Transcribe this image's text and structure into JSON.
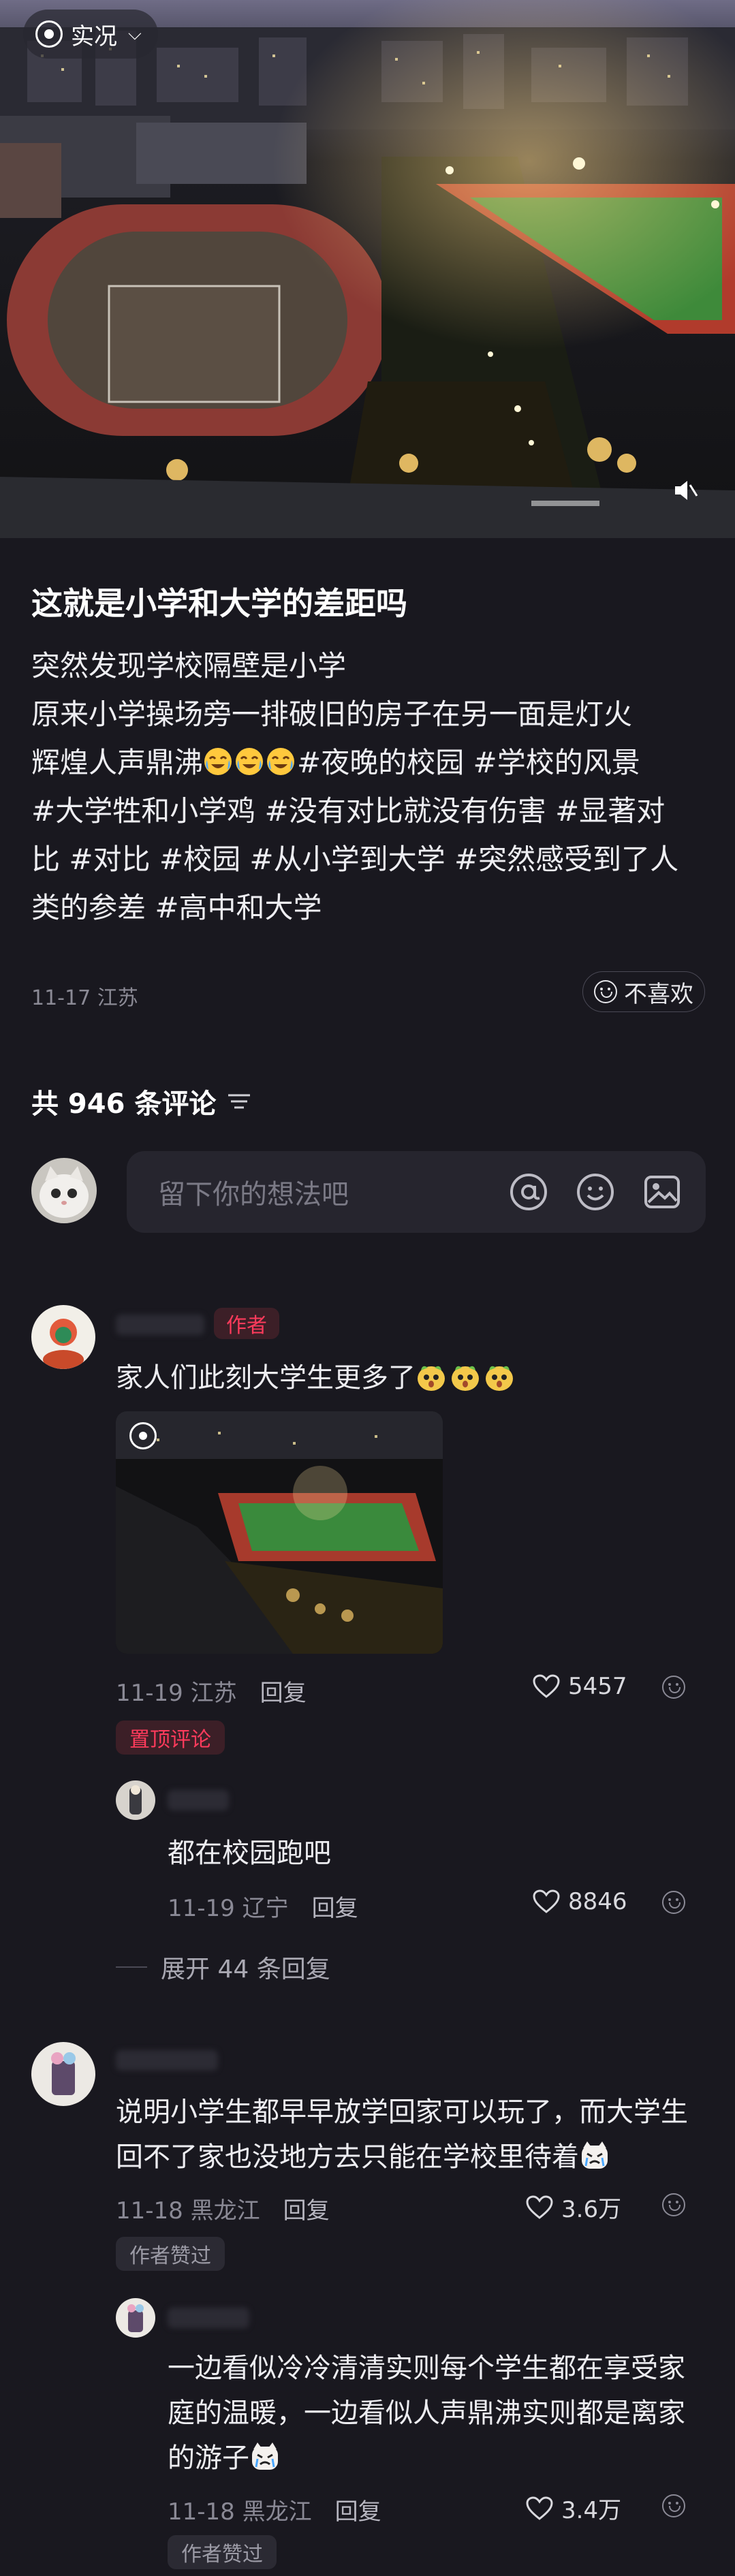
{
  "media": {
    "live_label": "实况",
    "mute_icon": "speaker-mute-icon"
  },
  "post": {
    "title": "这就是小学和大学的差距吗",
    "body_lines": [
      "突然发现学校隔壁是小学",
      "原来小学操场旁一排破旧的房子在另一面是灯火",
      "辉煌人声鼎沸",
      "#夜晚的校园 #学校的风景",
      "#大学牲和小学鸡 #没有对比就没有伤害 #显著对",
      "比 #对比 #校园 #从小学到大学 #突然感受到了人",
      "类的参差 #高中和大学"
    ],
    "date": "11-17",
    "location": "江苏",
    "dislike_label": "不喜欢"
  },
  "comments_header": {
    "count_text": "共 946 条评论"
  },
  "input": {
    "placeholder": "留下你的想法吧",
    "icons": [
      "at-icon",
      "emoji-icon",
      "image-icon"
    ]
  },
  "comments": [
    {
      "tag": "作者",
      "text": "家人们此刻大学生更多了",
      "date": "11-19",
      "location": "江苏",
      "reply": "回复",
      "likes": "5457",
      "badge": "置顶评论",
      "replies": [
        {
          "text": "都在校园跑吧",
          "date": "11-19",
          "location": "辽宁",
          "reply": "回复",
          "likes": "8846"
        }
      ],
      "expand": "展开 44 条回复"
    },
    {
      "text": "说明小学生都早早放学回家可以玩了，而大学生回不了家也没地方去只能在学校里待着",
      "date": "11-18",
      "location": "黑龙江",
      "reply": "回复",
      "likes": "3.6万",
      "badge": "作者赞过",
      "replies": [
        {
          "text": "一边看似冷冷清清实则每个学生都在享受家庭的温暖，一边看似人声鼎沸实则都是离家的游子",
          "date": "11-18",
          "location": "黑龙江",
          "reply": "回复",
          "likes": "3.4万",
          "badge": "作者赞过"
        }
      ]
    }
  ]
}
